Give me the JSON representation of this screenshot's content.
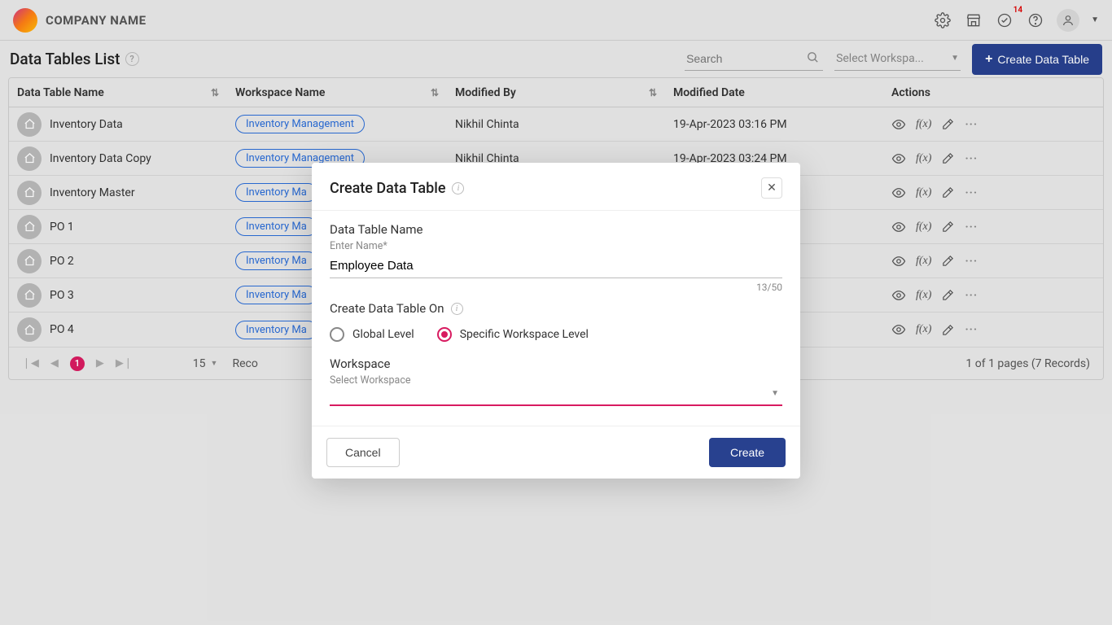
{
  "header": {
    "company_name": "COMPANY NAME",
    "notif_count": "14"
  },
  "page": {
    "title": "Data Tables List",
    "search_placeholder": "Search",
    "workspace_placeholder": "Select Workspa...",
    "create_button": "Create Data Table"
  },
  "table": {
    "columns": {
      "name": "Data Table Name",
      "workspace": "Workspace Name",
      "modified_by": "Modified By",
      "modified_date": "Modified Date",
      "actions": "Actions"
    },
    "rows": [
      {
        "name": "Inventory Data",
        "workspace": "Inventory Management",
        "modified_by": "Nikhil Chinta",
        "modified_date": "19-Apr-2023 03:16 PM"
      },
      {
        "name": "Inventory Data Copy",
        "workspace": "Inventory Management",
        "modified_by": "Nikhil Chinta",
        "modified_date": "19-Apr-2023 03:24 PM"
      },
      {
        "name": "Inventory Master",
        "workspace": "Inventory Ma",
        "modified_by": "",
        "modified_date": ""
      },
      {
        "name": "PO 1",
        "workspace": "Inventory Ma",
        "modified_by": "",
        "modified_date": ""
      },
      {
        "name": "PO 2",
        "workspace": "Inventory Ma",
        "modified_by": "",
        "modified_date": ""
      },
      {
        "name": "PO 3",
        "workspace": "Inventory Ma",
        "modified_by": "",
        "modified_date": ""
      },
      {
        "name": "PO 4",
        "workspace": "Inventory Ma",
        "modified_by": "",
        "modified_date": ""
      }
    ]
  },
  "pagination": {
    "current": "1",
    "page_size": "15",
    "records_label": "Reco",
    "info": "1 of 1 pages (7 Records)"
  },
  "modal": {
    "title": "Create Data Table",
    "name_label": "Data Table Name",
    "name_sub": "Enter Name*",
    "name_value": "Employee Data",
    "char_count": "13/50",
    "level_label": "Create Data Table On",
    "radio_global": "Global Level",
    "radio_specific": "Specific Workspace Level",
    "workspace_label": "Workspace",
    "workspace_sub": "Select Workspace",
    "cancel": "Cancel",
    "create": "Create"
  }
}
